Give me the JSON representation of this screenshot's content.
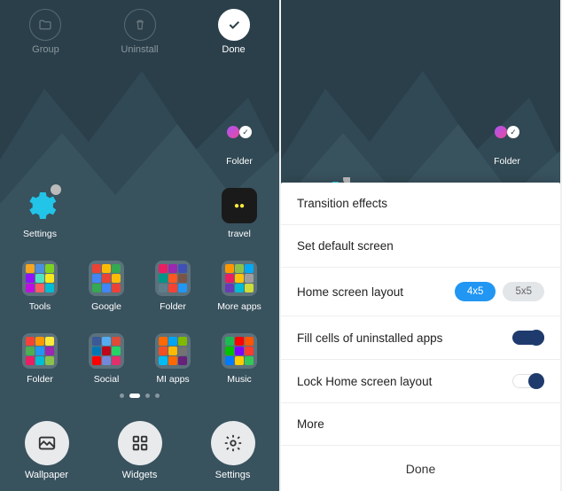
{
  "top_actions": {
    "group": "Group",
    "uninstall": "Uninstall",
    "done": "Done"
  },
  "left": {
    "row1": {
      "folder": "Folder"
    },
    "row2": {
      "settings": "Settings",
      "travel": "travel"
    },
    "row3": {
      "tools": "Tools",
      "google": "Google",
      "folder": "Folder",
      "more_apps": "More apps"
    },
    "row4": {
      "folder": "Folder",
      "social": "Social",
      "mi_apps": "MI apps",
      "music": "Music"
    }
  },
  "bottom_bar": {
    "wallpaper": "Wallpaper",
    "widgets": "Widgets",
    "settings": "Settings"
  },
  "right": {
    "row1": {
      "folder": "Folder"
    }
  },
  "sheet": {
    "transition": "Transition effects",
    "default_screen": "Set default screen",
    "layout_label": "Home screen layout",
    "layout_options": {
      "opt1": "4x5",
      "opt2": "5x5"
    },
    "fill_cells": "Fill cells of uninstalled apps",
    "lock_layout": "Lock Home screen layout",
    "more": "More",
    "done": "Done"
  },
  "folder_colors": {
    "tools": [
      "#f5a623",
      "#4a90e2",
      "#7ed321",
      "#9013fe",
      "#50e3c2",
      "#f8e71c",
      "#bd10e0",
      "#ff5e5e",
      "#00bcd4"
    ],
    "google": [
      "#ea4335",
      "#fbbc05",
      "#34a853",
      "#4285f4",
      "#ea4335",
      "#fbbc05",
      "#34a853",
      "#4285f4",
      "#ea4335"
    ],
    "folder3": [
      "#e91e63",
      "#9c27b0",
      "#3f51b5",
      "#009688",
      "#ff5722",
      "#795548",
      "#607d8b",
      "#f44336",
      "#2196f3"
    ],
    "more_apps": [
      "#ff9800",
      "#8bc34a",
      "#03a9f4",
      "#e91e63",
      "#ffc107",
      "#9e9e9e",
      "#673ab7",
      "#00bcd4",
      "#cddc39"
    ],
    "folder4": [
      "#f44336",
      "#ff9800",
      "#ffeb3b",
      "#4caf50",
      "#2196f3",
      "#9c27b0",
      "#e91e63",
      "#00bcd4",
      "#8bc34a"
    ],
    "social": [
      "#3b5998",
      "#55acee",
      "#dd4b39",
      "#0077b5",
      "#bd081c",
      "#25d366",
      "#ff0000",
      "#7289da",
      "#e1306c"
    ],
    "mi_apps": [
      "#ff6900",
      "#00a4ef",
      "#7fba00",
      "#f25022",
      "#ffb900",
      "#737373",
      "#00bcf2",
      "#ff6900",
      "#68217a"
    ],
    "music": [
      "#1db954",
      "#ff0000",
      "#ff5500",
      "#00c300",
      "#7d00ff",
      "#ff3b30",
      "#007aff",
      "#ffcc00",
      "#34c759"
    ]
  }
}
